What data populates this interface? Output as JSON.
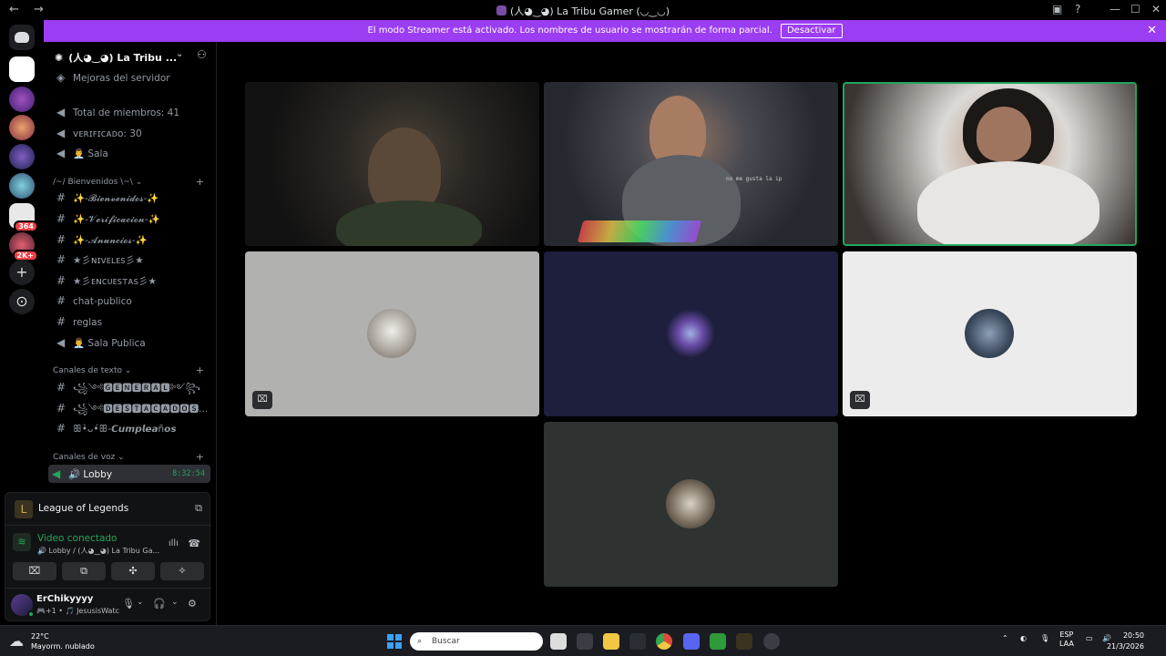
{
  "titlebar": {
    "title": "(人◕‿◕) La Tribu Gamer (◡‿◡)",
    "back": "←",
    "forward": "→"
  },
  "banner": {
    "message": "El modo Streamer está activado. Los nombres de usuario se mostrarán de forma parcial.",
    "button": "Desactivar",
    "close": "✕"
  },
  "server_list": {
    "badges": [
      "364",
      "2K+"
    ]
  },
  "server": {
    "name": "(人◕‿◕) La Tribu ...",
    "boost_label": "Mejoras del servidor"
  },
  "channels_top": [
    {
      "icon": "voice",
      "name": "Total de miembros: 41"
    },
    {
      "icon": "voice",
      "name": "ᴠᴇʀɪꜰɪᴄᴀᴅᴏ: 30"
    },
    {
      "icon": "voice",
      "name": "👨‍💼 Sala"
    }
  ],
  "categories": {
    "welcome": "/~/ Bienvenidos \\~\\",
    "text": "Canales de texto",
    "voice": "Canales de voz"
  },
  "channels_welcome": [
    {
      "icon": "#",
      "name": "✨-𝓑𝓲𝓮𝓷𝓿𝓮𝓷𝓲𝓭𝓸𝓼-✨"
    },
    {
      "icon": "#",
      "name": "✨-𝓥𝓮𝓻𝓲𝓯𝓲𝓬𝓪𝓬𝓲𝓸𝓷-✨"
    },
    {
      "icon": "#",
      "name": "✨-𝓐𝓷𝓾𝓷𝓬𝓲𝓸𝓼-✨"
    },
    {
      "icon": "#",
      "name": "★彡ɴɪᴠᴇʟᴇꜱ彡★"
    },
    {
      "icon": "#",
      "name": "★彡ᴇɴᴄᴜᴇꜱᴛᴀꜱ彡★"
    },
    {
      "icon": "#",
      "name": "chat-publico"
    },
    {
      "icon": "#",
      "name": "reglas"
    },
    {
      "icon": "voice",
      "name": "👨‍💼 Sala Publica"
    }
  ],
  "channels_text": [
    {
      "icon": "#",
      "name": "꧁༺🅶🅴🅽🅴🆁🅰🅻༻꧂"
    },
    {
      "icon": "#",
      "name": "꧁༺🅳🅴🆂🆃🅰🅲🅰🅳🅾🆂..."
    },
    {
      "icon": "#",
      "name": "ꕥ•̀ᴗ•́ꕥ-𝘾𝙪𝙢𝙥𝙡𝙚𝙖ñ𝙤𝙨"
    }
  ],
  "voice_active": {
    "name": "🔊 Lobby",
    "time": "8:32:54"
  },
  "activity": {
    "game": "League of Legends"
  },
  "voice_status": {
    "status": "Video conectado",
    "location": "🔊 Lobby / (人◕‿◕) La Tribu Ga..."
  },
  "user": {
    "name": "ErChikyyyy",
    "status": "🎮+1 • 🎵 JesusisWatc"
  },
  "taskbar": {
    "temp": "22°C",
    "condition": "Mayorm. nublado",
    "search_placeholder": "Buscar",
    "lang1": "ESP",
    "lang2": "LAA",
    "time": "20:50",
    "date": "21/3/2026"
  },
  "tiles": {
    "overlay_caption": "no me gusta la ip"
  }
}
